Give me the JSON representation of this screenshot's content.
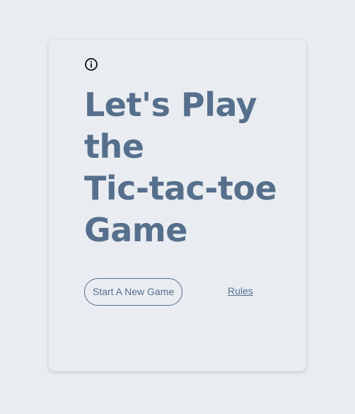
{
  "icons": {
    "info": "info-icon"
  },
  "title": {
    "lines": [
      "Let's Play",
      "the",
      "Tic-tac-toe",
      "Game"
    ]
  },
  "actions": {
    "start_label": "Start A New Game",
    "rules_label": "Rules"
  },
  "colors": {
    "background": "#e9edf2",
    "accent": "#566f8c",
    "icon": "#111111"
  }
}
